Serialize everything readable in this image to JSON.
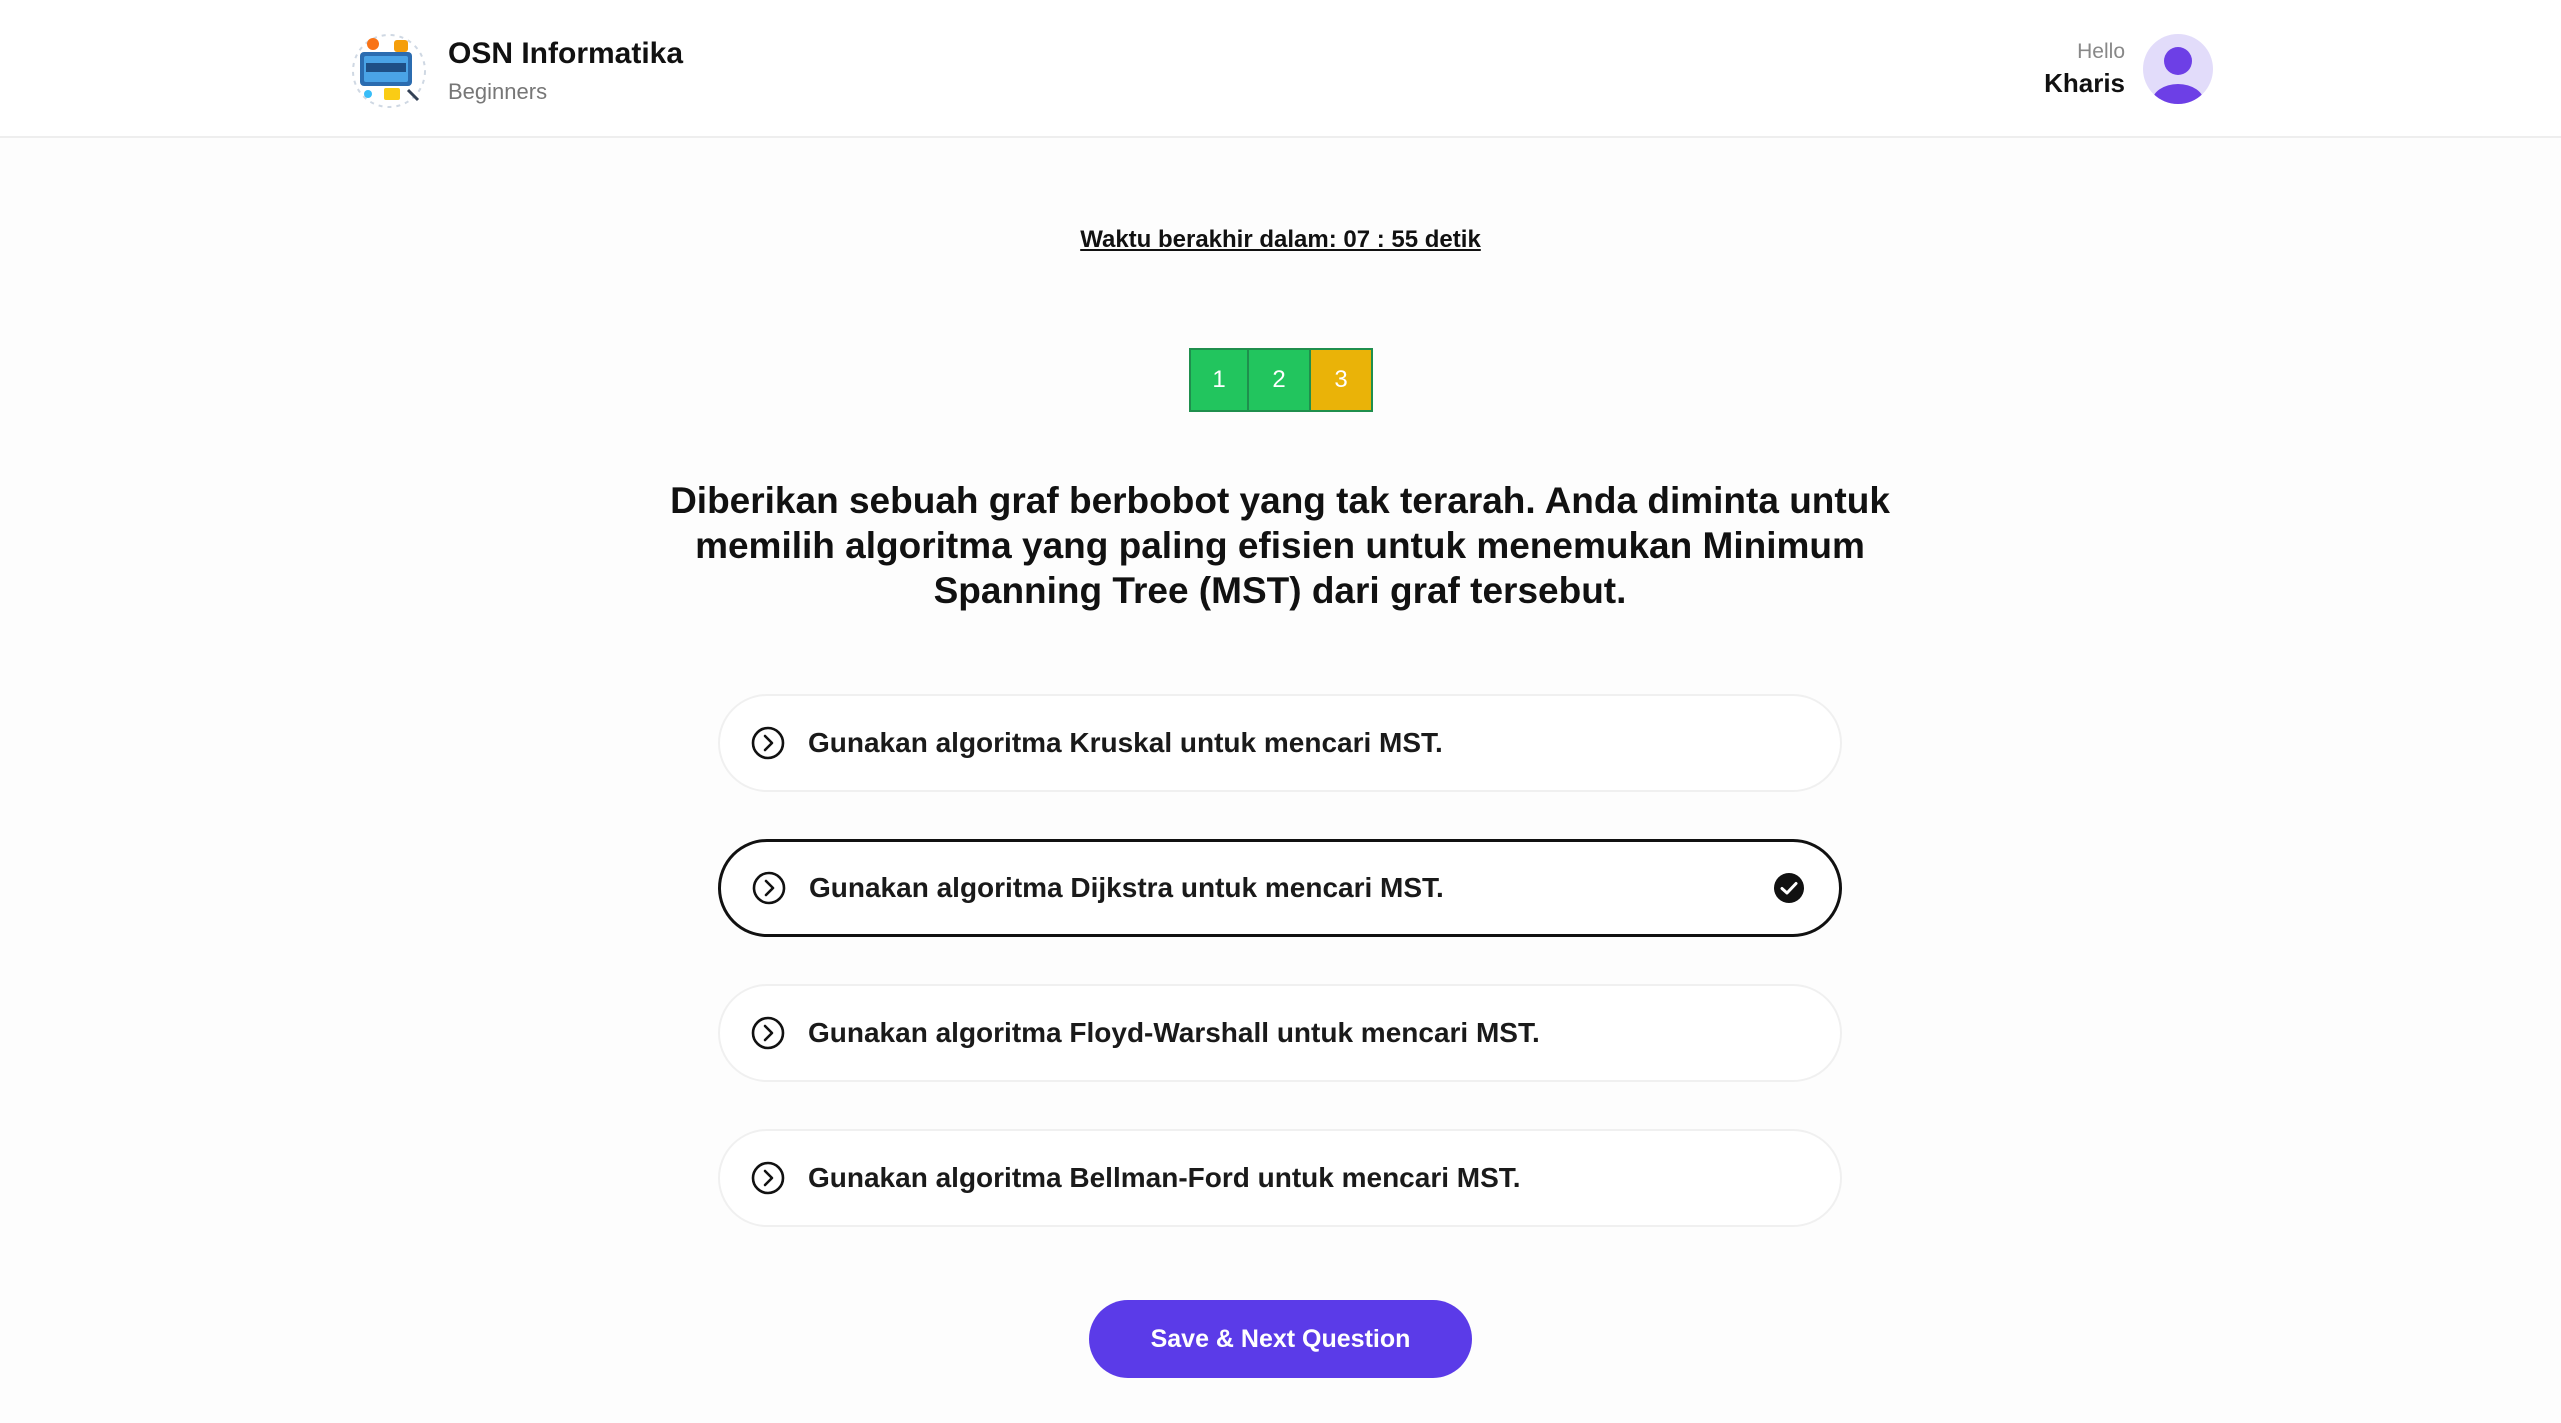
{
  "header": {
    "brand_title": "OSN Informatika",
    "brand_subtitle": "Beginners",
    "logo_icon": "technology-logo-icon",
    "greeting": "Hello",
    "user_name": "Kharis",
    "avatar_icon": "user-avatar-icon"
  },
  "timer": {
    "text": "Waktu berakhir dalam: 07 : 55 detik"
  },
  "question_nav": {
    "items": [
      {
        "label": "1",
        "status": "answered"
      },
      {
        "label": "2",
        "status": "answered"
      },
      {
        "label": "3",
        "status": "current"
      }
    ]
  },
  "question": {
    "text": "Diberikan sebuah graf berbobot yang tak terarah. Anda diminta untuk memilih algoritma yang paling efisien untuk menemukan Minimum Spanning Tree (MST) dari graf tersebut."
  },
  "options": [
    {
      "label": "Gunakan algoritma Kruskal untuk mencari MST.",
      "selected": false,
      "icon": "chevron-circle-right-icon"
    },
    {
      "label": "Gunakan algoritma Dijkstra untuk mencari MST.",
      "selected": true,
      "icon": "chevron-circle-right-icon"
    },
    {
      "label": "Gunakan algoritma Floyd-Warshall untuk mencari MST.",
      "selected": false,
      "icon": "chevron-circle-right-icon"
    },
    {
      "label": "Gunakan algoritma Bellman-Ford untuk mencari MST.",
      "selected": false,
      "icon": "chevron-circle-right-icon"
    }
  ],
  "actions": {
    "next_label": "Save & Next Question"
  },
  "colors": {
    "primary": "#5b3be8",
    "answered": "#22c55e",
    "current": "#eab308",
    "avatar_bg": "#e2dcfa"
  }
}
